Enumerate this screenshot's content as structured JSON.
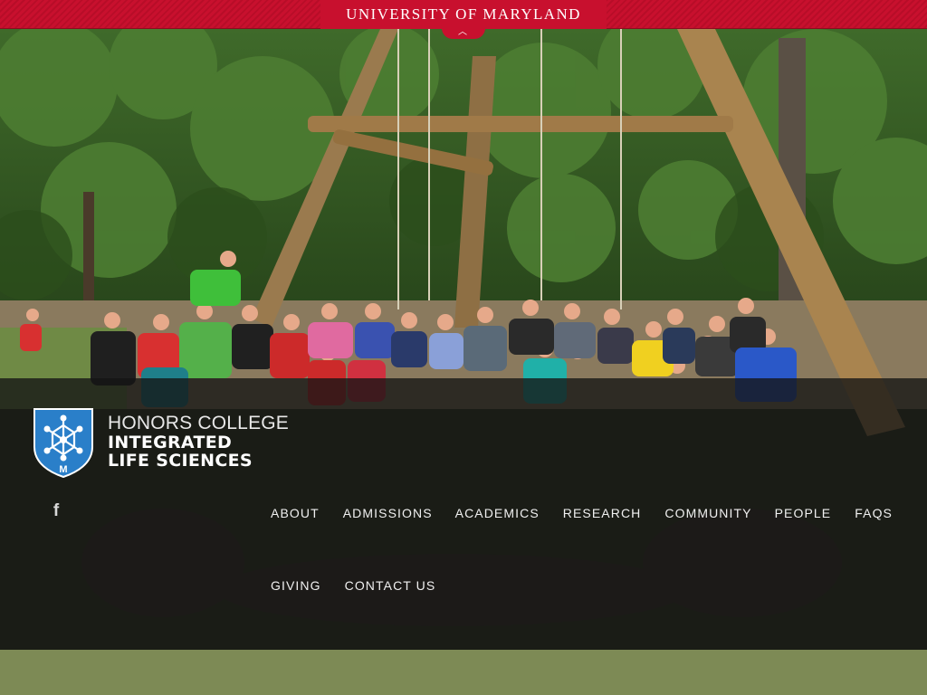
{
  "header": {
    "university_title": "UNIVERSITY OF MARYLAND",
    "accent_color": "#c8102e"
  },
  "logo": {
    "line1": "HONORS COLLEGE",
    "line2": "INTEGRATED",
    "line3": "LIFE SCIENCES",
    "shield_letter": "M",
    "shield_color": "#2a7fc9"
  },
  "social": {
    "facebook_glyph": "f",
    "facebook_icon": "facebook-icon"
  },
  "nav": {
    "items": [
      {
        "label": "ABOUT"
      },
      {
        "label": "ADMISSIONS"
      },
      {
        "label": "ACADEMICS"
      },
      {
        "label": "RESEARCH"
      },
      {
        "label": "COMMUNITY"
      },
      {
        "label": "PEOPLE"
      },
      {
        "label": "FAQS"
      },
      {
        "label": "GIVING"
      },
      {
        "label": "CONTACT US"
      }
    ]
  }
}
